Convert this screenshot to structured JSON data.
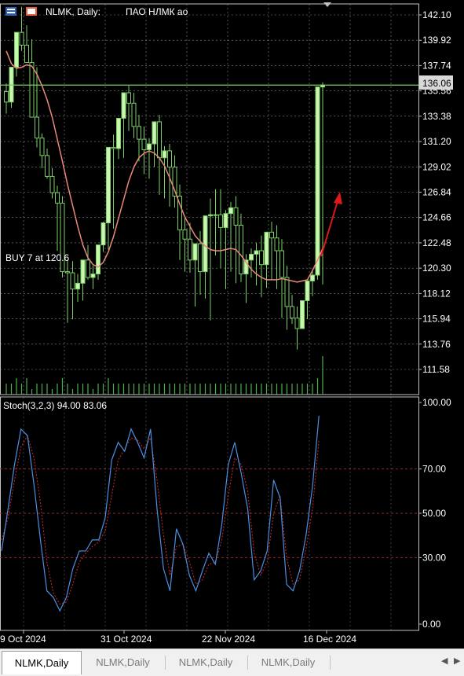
{
  "window": {
    "symbol_title": "NLMK, Daily: ",
    "company": "ПАО НЛМК ао"
  },
  "colors": {
    "background": "#000000",
    "grid": "#c0c0c0",
    "bull_candle": "#c9f7b0",
    "bear_candle": "#000000",
    "candle_outline": "#7ccf66",
    "volume": "#4db04d",
    "ma_line": "#e9897a",
    "price_line": "#7ccf66",
    "stoch_main": "#4a90e2",
    "stoch_signal": "#cc2b2b",
    "arrow": "#e01818",
    "text": "#ffffff"
  },
  "main_chart": {
    "price_labels": [
      "142.10",
      "139.92",
      "137.74",
      "135.56",
      "133.38",
      "131.20",
      "129.02",
      "126.84",
      "124.66",
      "122.48",
      "120.30",
      "118.12",
      "115.94",
      "113.76",
      "111.58"
    ],
    "current_price": "136.06",
    "trade_label": "BUY 7 at 120.6",
    "ylim": [
      110.5,
      143.2
    ]
  },
  "stoch_panel": {
    "title": "Stoch(3,2,3) 94.00 83.06",
    "levels": [
      "100.00",
      "70.00",
      "50.00",
      "30.00",
      "0.00"
    ],
    "ylim": [
      0,
      100
    ]
  },
  "x_axis": {
    "labels": [
      "9 Oct 2024",
      "31 Oct 2024",
      "22 Nov 2024",
      "16 Dec 2024"
    ]
  },
  "tabs": [
    {
      "label": "NLMK,Daily",
      "active": true
    },
    {
      "label": "NLMK,Daily",
      "active": false
    },
    {
      "label": "NLMK,Daily",
      "active": false
    },
    {
      "label": "NLMK,Daily",
      "active": false
    }
  ],
  "chart_data": {
    "type": "candlestick",
    "title": "NLMK, Daily",
    "current_price": 136.06,
    "open": [
      135.5,
      134.6,
      137.6,
      140.6,
      139.5,
      138.0,
      133.3,
      131.5,
      130.0,
      128.2,
      126.8,
      125.9,
      120.0,
      119.9,
      118.5,
      119.0,
      121.0,
      119.5,
      119.8,
      122.3,
      124.2,
      130.7,
      130.6,
      133.2,
      135.4,
      134.5,
      132.5,
      131.4,
      130.5,
      131.0,
      132.9,
      129.8,
      130.4,
      129.0,
      126.5,
      123.6,
      122.8,
      121.0,
      122.4,
      120.0,
      124.8,
      124.9,
      124.9,
      123.8,
      125.0,
      125.5,
      124.0,
      119.8,
      121.0,
      121.5,
      121.8,
      120.6,
      123.4,
      122.9,
      121.8,
      119.5,
      117.0,
      116.0,
      115.1,
      117.5,
      119.2,
      119.7,
      135.9
    ],
    "high": [
      136.2,
      136.5,
      139.9,
      142.8,
      141.2,
      140.0,
      137.6,
      131.9,
      130.6,
      128.9,
      127.4,
      126.5,
      121.0,
      120.9,
      119.8,
      121.0,
      122.3,
      120.5,
      121.8,
      124.3,
      125.5,
      131.8,
      132.9,
      135.2,
      136.0,
      135.4,
      133.5,
      132.5,
      131.5,
      131.8,
      133.5,
      130.8,
      131.0,
      130.0,
      127.5,
      124.6,
      124.2,
      122.0,
      123.5,
      121.5,
      126.3,
      127.1,
      127.1,
      125.3,
      126.0,
      126.5,
      125.0,
      121.5,
      122.0,
      122.5,
      123.1,
      121.6,
      124.3,
      124.0,
      122.8,
      120.5,
      118.0,
      117.0,
      116.3,
      118.5,
      120.2,
      121.0,
      136.3
    ],
    "low": [
      133.6,
      134.1,
      136.8,
      139.0,
      138.2,
      136.0,
      130.7,
      128.9,
      128.0,
      126.3,
      121.8,
      119.5,
      115.6,
      115.9,
      117.4,
      117.5,
      119.3,
      118.5,
      119.3,
      121.7,
      121.9,
      123.7,
      129.7,
      129.8,
      132.1,
      131.5,
      129.5,
      128.4,
      128.0,
      129.0,
      126.6,
      126.3,
      125.6,
      125.5,
      121.0,
      120.0,
      119.9,
      117.0,
      118.0,
      117.7,
      115.8,
      121.4,
      120.3,
      118.5,
      120.0,
      119.0,
      119.1,
      117.3,
      119.5,
      118.8,
      117.8,
      118.6,
      119.3,
      118.5,
      116.0,
      115.0,
      115.5,
      113.3,
      115.1,
      115.9,
      117.9,
      119.3,
      118.9
    ],
    "close": [
      134.6,
      137.6,
      140.6,
      139.5,
      138.0,
      133.3,
      131.5,
      130.0,
      128.2,
      126.8,
      125.9,
      120.0,
      119.9,
      118.5,
      119.0,
      121.0,
      119.5,
      119.8,
      122.3,
      124.2,
      130.7,
      130.6,
      133.2,
      135.4,
      134.5,
      132.5,
      131.4,
      130.5,
      131.0,
      132.9,
      129.8,
      130.4,
      129.0,
      126.5,
      123.6,
      122.8,
      121.0,
      122.4,
      120.0,
      124.8,
      124.9,
      124.9,
      123.8,
      125.0,
      125.5,
      124.0,
      119.8,
      121.0,
      121.5,
      121.8,
      120.6,
      123.4,
      122.9,
      121.8,
      119.5,
      117.0,
      116.0,
      115.1,
      117.5,
      119.2,
      119.7,
      135.9,
      136.06
    ],
    "ma": [
      139.0,
      137.9,
      137.5,
      137.6,
      137.8,
      137.7,
      137.0,
      136.0,
      134.8,
      133.3,
      131.4,
      129.5,
      127.5,
      125.7,
      123.9,
      122.3,
      121.2,
      120.6,
      120.4,
      120.8,
      121.7,
      123.0,
      124.6,
      126.2,
      127.8,
      129.0,
      129.8,
      130.2,
      130.4,
      130.2,
      129.8,
      129.1,
      128.1,
      127.0,
      125.8,
      124.7,
      123.9,
      123.1,
      122.6,
      122.2,
      121.9,
      121.8,
      121.8,
      121.9,
      122.0,
      121.9,
      121.4,
      120.8,
      120.2,
      119.8,
      119.5,
      119.3,
      119.3,
      119.3,
      119.4,
      119.3,
      119.2,
      119.1,
      119.2,
      119.3,
      120.1,
      121.0,
      122.0
    ],
    "volume": [
      2,
      2,
      3,
      2,
      3,
      1,
      2,
      2,
      2,
      1,
      2,
      3,
      2,
      1,
      2,
      2,
      2,
      1,
      2,
      2,
      3,
      2,
      2,
      2,
      2,
      2,
      2,
      2,
      2,
      2,
      2,
      2,
      2,
      2,
      2,
      2,
      2,
      2,
      2,
      2,
      2,
      2,
      2,
      2,
      2,
      2,
      2,
      2,
      2,
      2,
      2,
      2,
      2,
      2,
      2,
      2,
      2,
      2,
      2,
      2,
      2,
      3,
      7
    ],
    "stoch_k": [
      33,
      52,
      72,
      88,
      85,
      63,
      38,
      15,
      12,
      6,
      12,
      25,
      33,
      33,
      38,
      38,
      48,
      74,
      82,
      78,
      88,
      82,
      75,
      88,
      52,
      25,
      15,
      43,
      36,
      22,
      15,
      24,
      32,
      27,
      45,
      72,
      82,
      68,
      52,
      20,
      24,
      33,
      65,
      57,
      18,
      15,
      24,
      40,
      62,
      94
    ],
    "stoch_d": [
      38,
      48,
      65,
      80,
      85,
      75,
      55,
      28,
      14,
      9,
      10,
      18,
      28,
      32,
      35,
      37,
      42,
      58,
      74,
      79,
      84,
      83,
      79,
      84,
      65,
      40,
      22,
      35,
      36,
      28,
      18,
      20,
      27,
      28,
      38,
      58,
      75,
      72,
      60,
      32,
      22,
      28,
      50,
      58,
      30,
      18,
      20,
      34,
      52,
      83
    ],
    "stoch_ylim": [
      0,
      100
    ]
  }
}
